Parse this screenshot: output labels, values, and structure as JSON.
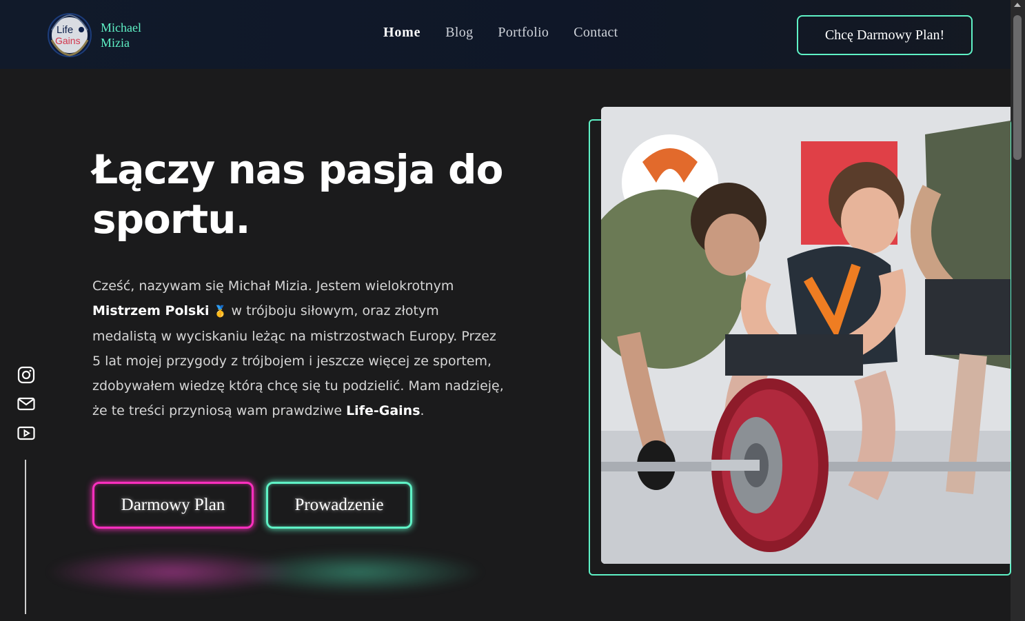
{
  "brand": {
    "logo_text_1": "Life",
    "logo_text_2": "Gains",
    "name_line1": "Michael",
    "name_line2": "Mizia"
  },
  "nav": {
    "items": [
      {
        "label": "Home",
        "active": true
      },
      {
        "label": "Blog"
      },
      {
        "label": "Portfolio"
      },
      {
        "label": "Contact"
      }
    ]
  },
  "header_cta": "Chcę Darmowy Plan!",
  "hero": {
    "title_line1": "Łączy nas pasja do",
    "title_line2": "sportu.",
    "p_1": "Cześć, nazywam się Michał Mizia. Jestem wielokrotnym",
    "p_bold_1": "Mistrzem Polski",
    "p_medal": "🥇",
    "p_2": "w trójboju siłowym, oraz złotym medalistą w wyciskaniu leżąc na mistrzostwach Europy. Przez 5 lat mojej przygody z trójbojem i jeszcze więcej ze sportem, zdobywałem wiedzę którą chcę się tu podzielić. Mam nadzieję, że te treści przyniosą wam prawdziwe",
    "p_bold_2": "Life-Gains",
    "p_end": ".",
    "btn_primary": "Darmowy Plan",
    "btn_secondary": "Prowadzenie"
  },
  "social": {
    "icons": [
      "instagram-icon",
      "mail-icon",
      "youtube-icon"
    ]
  },
  "colors": {
    "accent_teal": "#5ff2c6",
    "accent_pink": "#ff2fbf",
    "background": "#1b1b1c"
  }
}
